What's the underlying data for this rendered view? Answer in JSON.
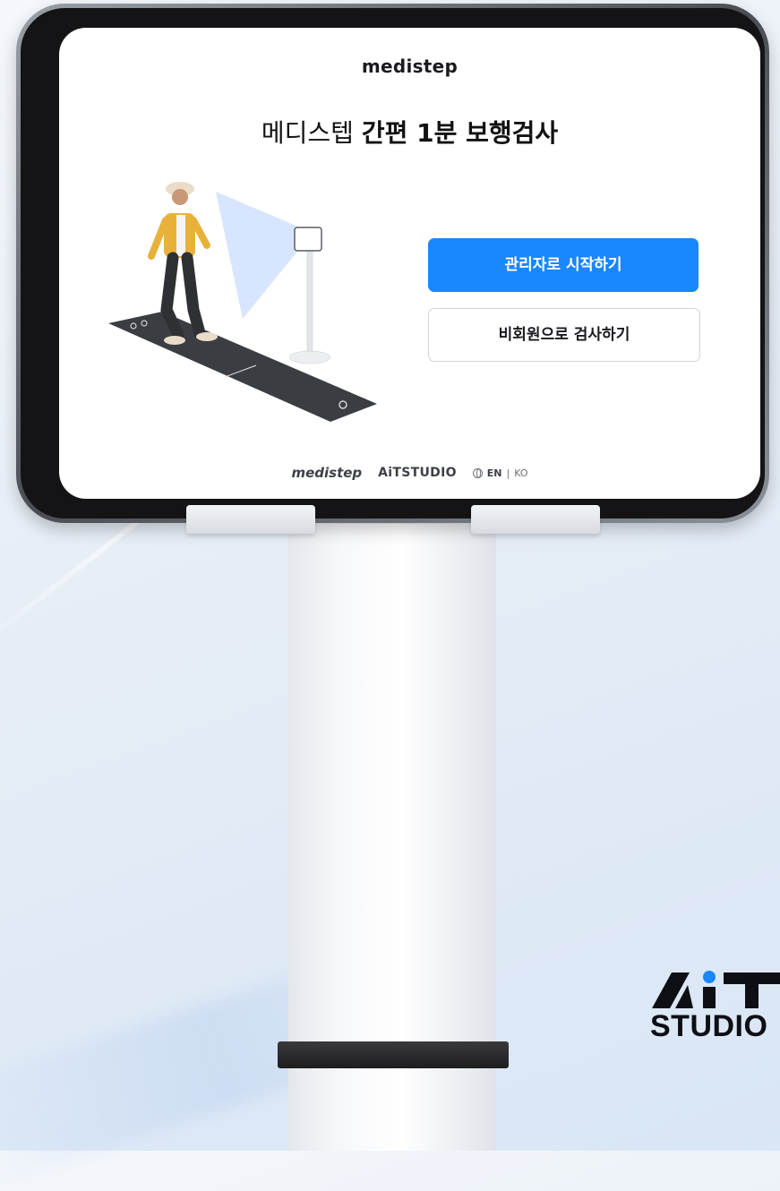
{
  "app": {
    "logo_text": "medistep",
    "title_regular": "메디스텝 ",
    "title_bold": "간편 1분 보행검사"
  },
  "buttons": {
    "admin_start": "관리자로 시작하기",
    "guest_test": "비회원으로 검사하기"
  },
  "footer": {
    "medistep": "medistep",
    "aitstudio": "AiTSTUDIO",
    "lang_current": "EN",
    "lang_separator": "|",
    "lang_other": "KO"
  },
  "brand": {
    "mark": "AiT",
    "text": "STUDIO"
  },
  "colors": {
    "primary": "#1a86ff",
    "logo_accent": "#1a6ff5"
  },
  "icons": [
    "globe-icon",
    "walking-person-illustration",
    "camera-stand-illustration"
  ]
}
